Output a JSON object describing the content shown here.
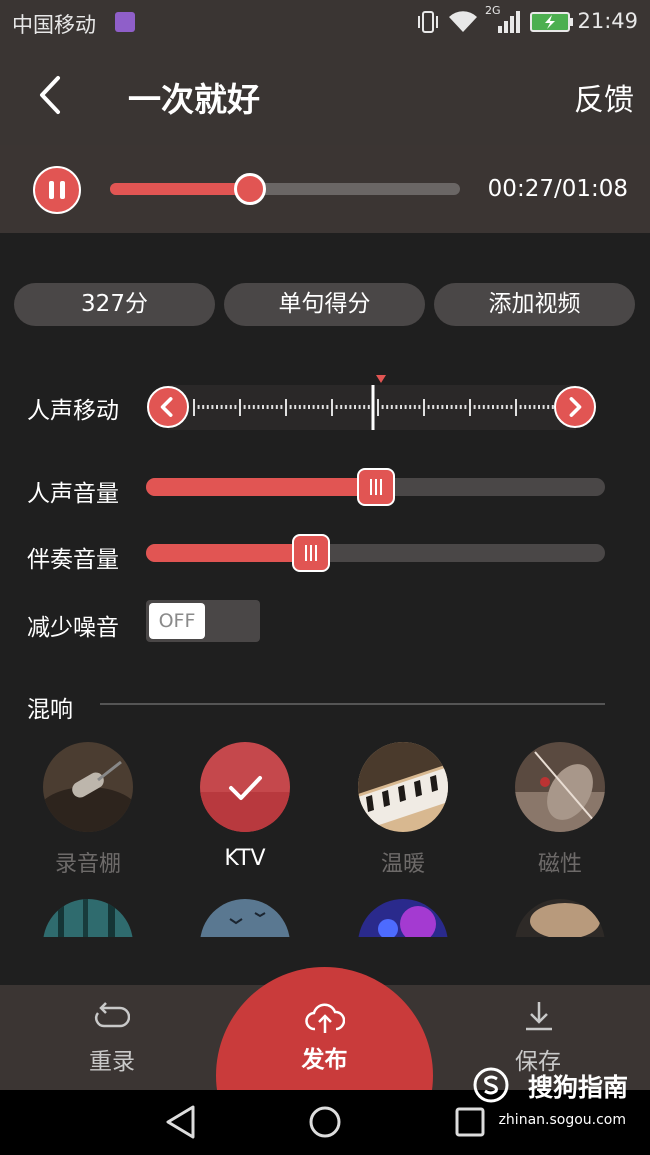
{
  "status_bar": {
    "carrier": "中国移动",
    "network": "2G",
    "time": "21:49"
  },
  "header": {
    "title": "一次就好",
    "feedback_label": "反馈"
  },
  "playback": {
    "time": "00:27/01:08",
    "progress_fraction": 0.4
  },
  "pills": [
    {
      "label": "327分"
    },
    {
      "label": "单句得分"
    },
    {
      "label": "添加视频"
    }
  ],
  "controls": {
    "vocal_shift_label": "人声移动",
    "vocal_volume_label": "人声音量",
    "vocal_volume_fraction": 0.5,
    "accompaniment_label": "伴奏音量",
    "accompaniment_fraction": 0.36,
    "noise_reduction_label": "减少噪音",
    "noise_reduction_value": "OFF"
  },
  "reverb": {
    "section_label": "混响",
    "effects": [
      {
        "label": "录音棚",
        "selected": false,
        "icon": "microphone-image"
      },
      {
        "label": "KTV",
        "selected": true,
        "icon": "check-icon"
      },
      {
        "label": "温暖",
        "selected": false,
        "icon": "piano-image"
      },
      {
        "label": "磁性",
        "selected": false,
        "icon": "violin-image"
      }
    ]
  },
  "bottom_bar": {
    "rerecord_label": "重录",
    "publish_label": "发布",
    "save_label": "保存"
  },
  "watermark": {
    "text": "搜狗指南",
    "sub": "zhinan.sogou.com"
  },
  "colors": {
    "accent": "#e15553",
    "publish": "#c93b3b",
    "bar_bg": "#3b3533",
    "page_bg": "#1f1f1f"
  }
}
